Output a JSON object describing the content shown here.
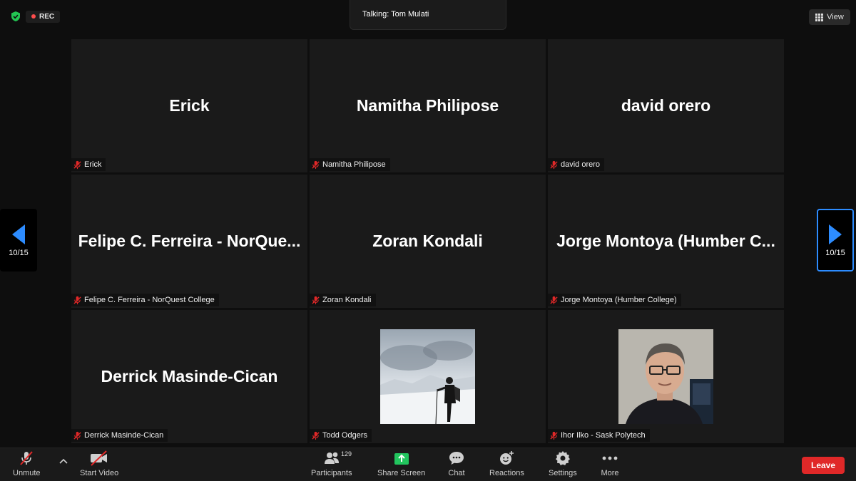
{
  "recording": {
    "label": "REC"
  },
  "talking": {
    "text": "Talking: Tom Mulati"
  },
  "view": {
    "label": "View"
  },
  "pager": {
    "left": "10/15",
    "right": "10/15"
  },
  "tiles": [
    {
      "display": "Erick",
      "tag": "Erick"
    },
    {
      "display": "Namitha Philipose",
      "tag": "Namitha Philipose"
    },
    {
      "display": "david orero",
      "tag": "david orero"
    },
    {
      "display": "Felipe C. Ferreira - NorQue...",
      "tag": "Felipe C. Ferreira - NorQuest College"
    },
    {
      "display": "Zoran Kondali",
      "tag": "Zoran Kondali"
    },
    {
      "display": "Jorge Montoya (Humber C...",
      "tag": "Jorge Montoya (Humber College)"
    },
    {
      "display": "Derrick Masinde-Cican",
      "tag": "Derrick Masinde-Cican"
    },
    {
      "display": "",
      "tag": "Todd Odgers"
    },
    {
      "display": "",
      "tag": "Ihor Ilko - Sask Polytech"
    }
  ],
  "toolbar": {
    "unmute": "Unmute",
    "start_video": "Start Video",
    "participants": "Participants",
    "participants_count": "129",
    "share_screen": "Share Screen",
    "chat": "Chat",
    "reactions": "Reactions",
    "settings": "Settings",
    "more": "More",
    "leave": "Leave"
  },
  "colors": {
    "accent": "#2d8cff",
    "leave": "#e02828",
    "share": "#22c55e",
    "muted": "#e02828"
  }
}
